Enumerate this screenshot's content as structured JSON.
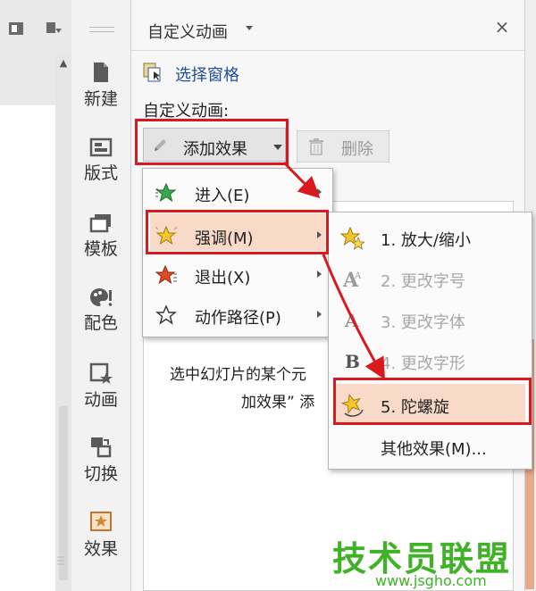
{
  "task_pane": {
    "title": "自定义动画",
    "close_glyph": "×",
    "select_pane_link": "选择窗格",
    "custom_animation_label": "自定义动画:",
    "add_effect_label": "添加效果",
    "delete_label": "删除",
    "hint_line_1": "选中幻灯片的某个元",
    "hint_line_2": "加效果” 添"
  },
  "side_toolbar": {
    "items": [
      {
        "label": "新建",
        "icon": "new-doc-icon"
      },
      {
        "label": "版式",
        "icon": "layout-icon"
      },
      {
        "label": "模板",
        "icon": "template-icon"
      },
      {
        "label": "配色",
        "icon": "palette-icon"
      },
      {
        "label": "动画",
        "icon": "animation-icon"
      },
      {
        "label": "切换",
        "icon": "transition-icon"
      },
      {
        "label": "效果",
        "icon": "effect-icon"
      }
    ]
  },
  "add_effect_menu": {
    "items": [
      {
        "label": "进入(E)",
        "icon": "green-star-icon",
        "has_submenu": true
      },
      {
        "label": "强调(M)",
        "icon": "yellow-star-icon",
        "has_submenu": true,
        "highlighted": true
      },
      {
        "label": "退出(X)",
        "icon": "red-star-icon",
        "has_submenu": true
      },
      {
        "label": "动作路径(P)",
        "icon": "outline-star-icon",
        "has_submenu": true
      }
    ]
  },
  "emphasis_submenu": {
    "items": [
      {
        "label": "1. 放大/缩小",
        "icon": "grow-shrink-star-icon",
        "enabled": true
      },
      {
        "label": "2. 更改字号",
        "icon": "font-size-icon",
        "enabled": false
      },
      {
        "label": "3. 更改字体",
        "icon": "font-face-icon",
        "enabled": false
      },
      {
        "label": "4. 更改字形",
        "icon": "font-style-icon",
        "enabled": false
      },
      {
        "label": "5. 陀螺旋",
        "icon": "spin-star-icon",
        "enabled": true,
        "highlighted": true
      },
      {
        "label": "其他效果(M)...",
        "icon": "",
        "enabled": true
      }
    ]
  },
  "watermark": {
    "text": "技术员联盟",
    "url": "www.jsgho.com"
  },
  "colors": {
    "highlight_red": "#d9191e",
    "hover_peach": "#f9d9c7",
    "link_blue": "#1f4e9a",
    "watermark_green": "#3fb227"
  }
}
